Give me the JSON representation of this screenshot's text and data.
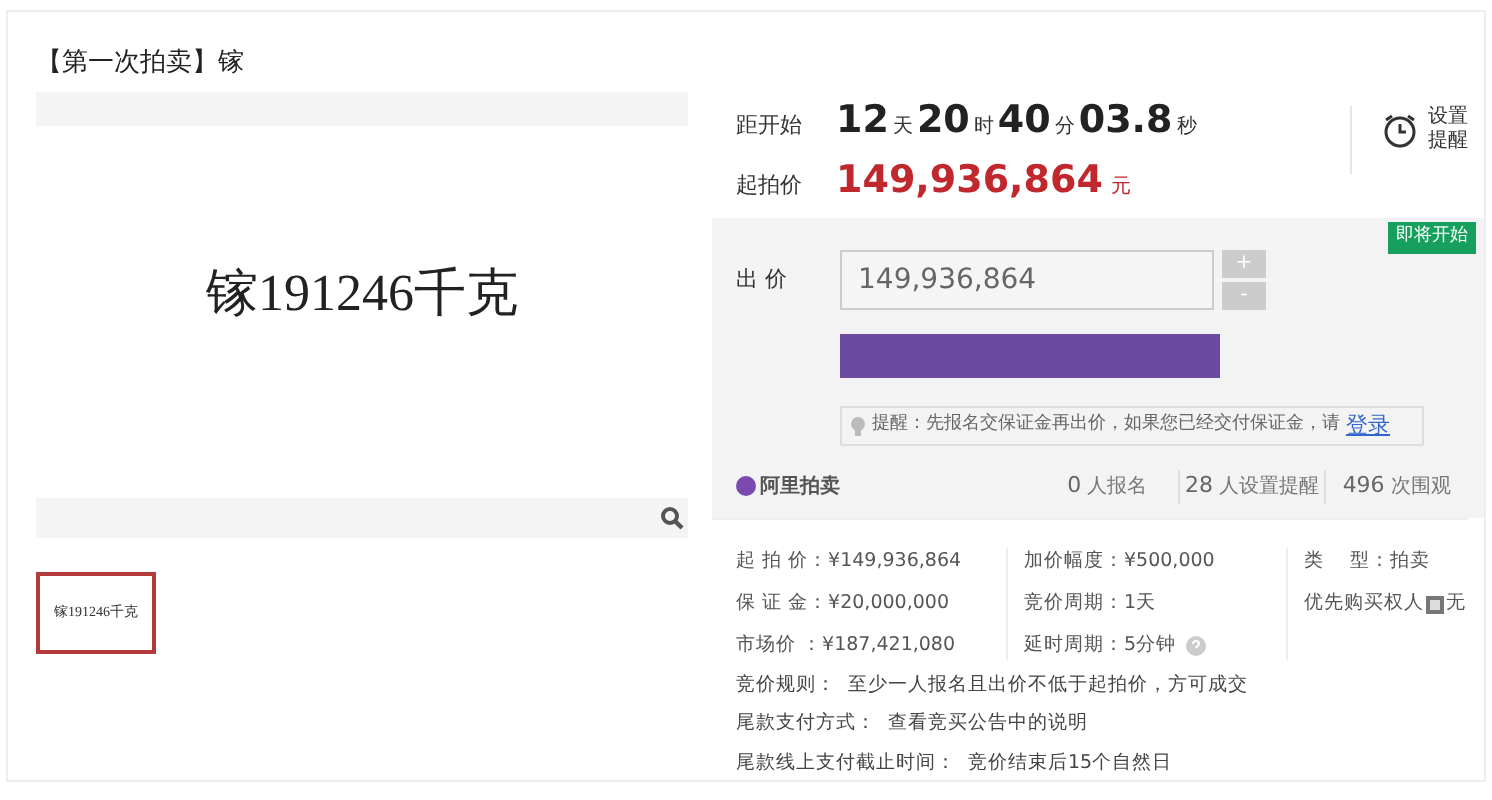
{
  "title": "【第一次拍卖】镓",
  "image_caption": "镓191246千克",
  "thumbnails": [
    {
      "caption": "镓191246千克",
      "selected": true
    }
  ],
  "countdown": {
    "label": "距开始",
    "parts": [
      {
        "value": "12",
        "unit": "天"
      },
      {
        "value": "20",
        "unit": "时"
      },
      {
        "value": "40",
        "unit": "分"
      },
      {
        "value": "03.8",
        "unit": "秒"
      }
    ]
  },
  "reminder_button": {
    "lines": [
      "设置",
      "提醒"
    ]
  },
  "start_price": {
    "label": "起拍价",
    "value": "149,936,864",
    "unit": "元"
  },
  "status_badge": "即将开始",
  "bid": {
    "label": "出 价",
    "value": "149,936,864",
    "increment": "+",
    "decrement": "-"
  },
  "notice": {
    "text": "提醒：先报名交保证金再出价，如果您已经交付保证金，请",
    "link": "登录"
  },
  "brand": "阿里拍卖",
  "stats": [
    {
      "count": "0",
      "label": "人报名"
    },
    {
      "count": "28",
      "label": "人设置提醒"
    },
    {
      "count": "496",
      "label": "次围观"
    }
  ],
  "details": [
    [
      {
        "label": "起 拍 价：",
        "value": "¥149,936,864"
      },
      {
        "label": "保 证 金：",
        "value": "¥20,000,000"
      },
      {
        "label": "市场价 ：",
        "value": "¥187,421,080"
      }
    ],
    [
      {
        "label": "加价幅度：",
        "value": "¥500,000"
      },
      {
        "label": "竞价周期：",
        "value": "1天"
      },
      {
        "label": "延时周期：",
        "value": "5分钟",
        "help": true
      }
    ],
    [
      {
        "label": "类　 型：",
        "value": "拍卖"
      },
      {
        "label": "优先购买权人",
        "value": "无",
        "badge": true
      }
    ]
  ],
  "rules": [
    {
      "label": "竞价规则：",
      "value": "至少一人报名且出价不低于起拍价，方可成交"
    },
    {
      "label": "尾款支付方式：",
      "value": "查看竞买公告中的说明"
    },
    {
      "label": "尾款线上支付截止时间：",
      "value": "竞价结束后15个自然日"
    }
  ]
}
